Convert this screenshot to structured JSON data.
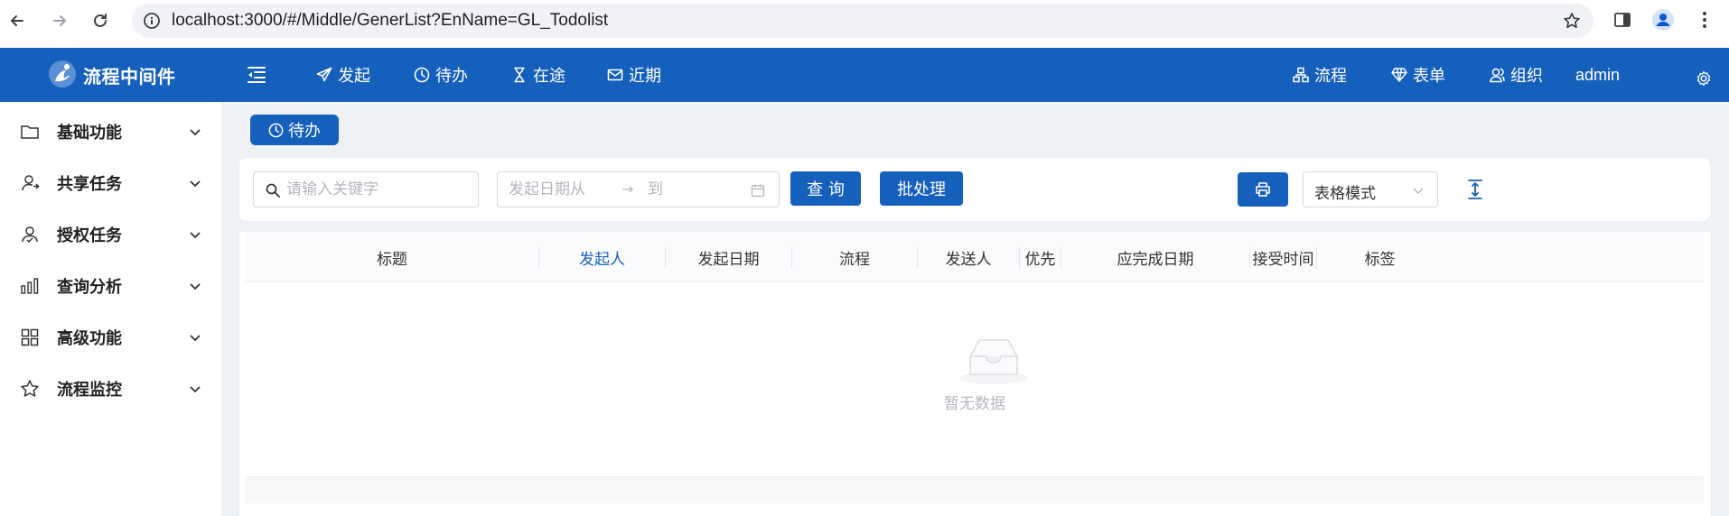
{
  "browser": {
    "url": "localhost:3000/#/Middle/GenerList?EnName=GL_Todolist"
  },
  "header": {
    "app_title": "流程中间件",
    "nav_left": [
      {
        "label": "发起",
        "icon": "paper-plane-icon"
      },
      {
        "label": "待办",
        "icon": "clock-icon"
      },
      {
        "label": "在途",
        "icon": "hourglass-icon"
      },
      {
        "label": "近期",
        "icon": "mail-icon"
      }
    ],
    "nav_right": [
      {
        "label": "流程",
        "icon": "flow-icon"
      },
      {
        "label": "表单",
        "icon": "diamond-icon"
      },
      {
        "label": "组织",
        "icon": "users-icon"
      }
    ],
    "username": "admin",
    "brand_color": "#1560bd"
  },
  "sidebar": {
    "items": [
      {
        "label": "基础功能",
        "icon": "folder-icon"
      },
      {
        "label": "共享任务",
        "icon": "user-share-icon"
      },
      {
        "label": "授权任务",
        "icon": "user-auth-icon"
      },
      {
        "label": "查询分析",
        "icon": "bar-chart-icon"
      },
      {
        "label": "高级功能",
        "icon": "grid-icon"
      },
      {
        "label": "流程监控",
        "icon": "star-icon"
      }
    ]
  },
  "main": {
    "active_tab": "待办",
    "search": {
      "placeholder": "请输入关键字",
      "value": ""
    },
    "date_range": {
      "from_placeholder": "发起日期从",
      "to_placeholder": "到"
    },
    "query_button": "查 询",
    "batch_button": "批处理",
    "view_mode": "表格模式",
    "table": {
      "columns": [
        "标题",
        "发起人",
        "发起日期",
        "流程",
        "发送人",
        "优先",
        "应完成日期",
        "接受时间",
        "标签"
      ],
      "sorted_column": "发起人",
      "rows": [],
      "empty_text": "暂无数据"
    }
  }
}
